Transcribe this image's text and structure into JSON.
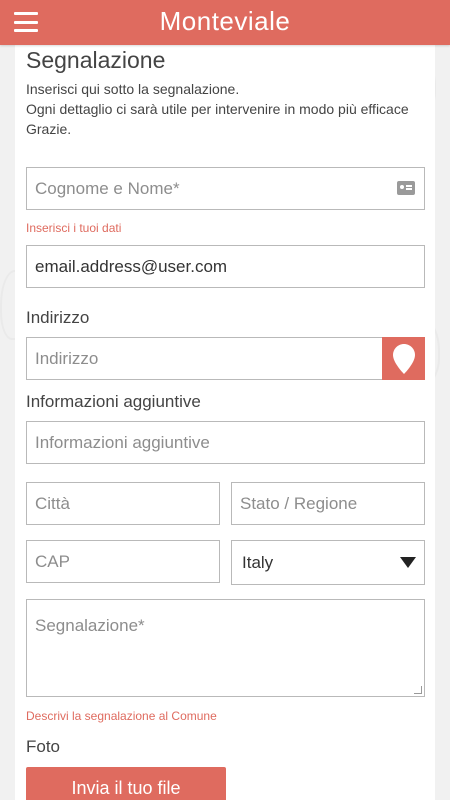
{
  "header": {
    "title": "Monteviale",
    "menu_icon": "hamburger-icon"
  },
  "form": {
    "title": "Segnalazione",
    "intro_line1": "Inserisci  qui sotto la segnalazione.",
    "intro_line2": "Ogni dettaglio ci sarà utile per intervenire in modo più efficace",
    "intro_line3": "Grazie.",
    "name_placeholder": "Cognome e Nome*",
    "name_icon": "id-card-icon",
    "name_error": "Inserisci i tuoi dati",
    "email_value": "email.address@user.com",
    "address_label": "Indirizzo",
    "address_placeholder": "Indirizzo",
    "location_icon": "map-pin-icon",
    "extra_label": "Informazioni aggiuntive",
    "extra_placeholder": "Informazioni aggiuntive",
    "city_placeholder": "Città",
    "region_placeholder": "Stato / Regione",
    "cap_placeholder": "CAP",
    "country_value": "Italy",
    "report_placeholder": "Segnalazione*",
    "report_error": "Descrivi la segnalazione al Comune",
    "photo_label": "Foto",
    "upload_button": "Invia il tuo file"
  },
  "colors": {
    "accent": "#df6b5f",
    "background": "#f1f1f1",
    "panel": "#ffffff"
  }
}
